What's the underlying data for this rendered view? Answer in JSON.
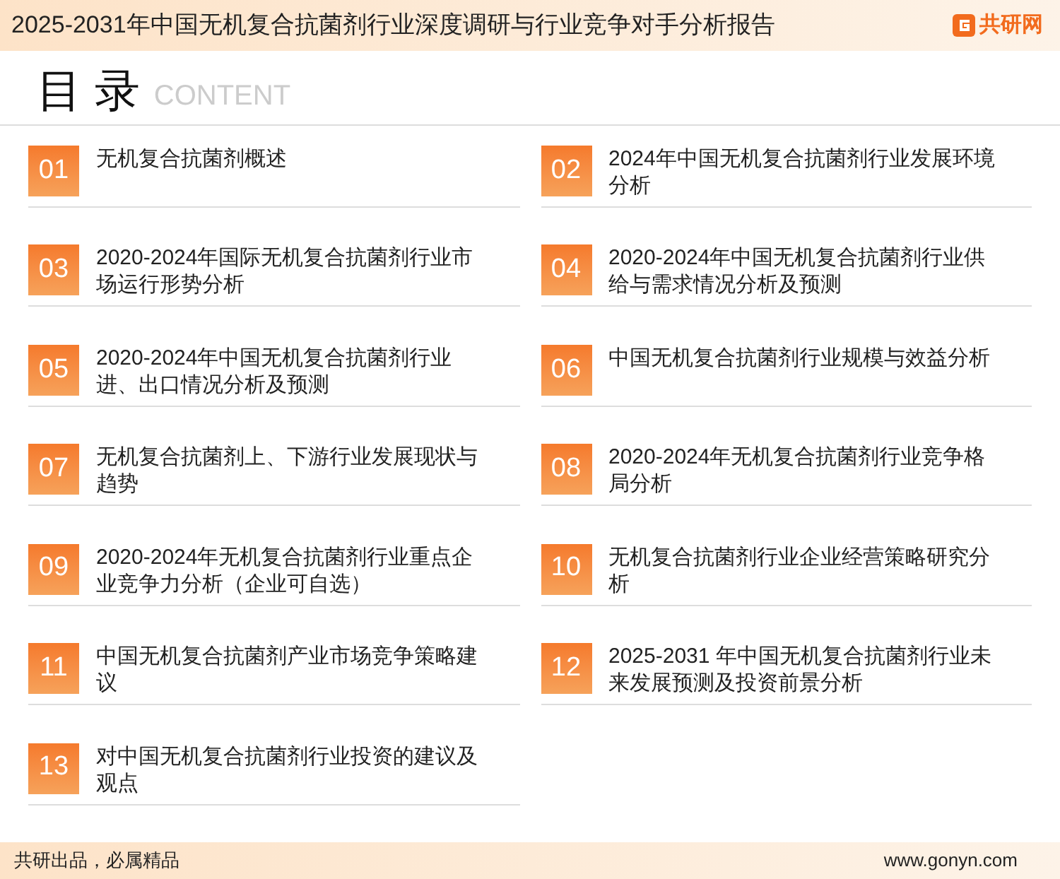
{
  "header": {
    "title": "2025-2031年中国无机复合抗菌剂行业深度调研与行业竞争对手分析报告",
    "logo": "共研网"
  },
  "section": {
    "title": "目 录",
    "subtitle": "CONTENT"
  },
  "items": [
    {
      "number": "01",
      "text": "无机复合抗菌剂概述"
    },
    {
      "number": "02",
      "text": "2024年中国无机复合抗菌剂行业发展环境分析"
    },
    {
      "number": "03",
      "text": "2020-2024年国际无机复合抗菌剂行业市场运行形势分析"
    },
    {
      "number": "04",
      "text": "2020-2024年中国无机复合抗菌剂行业供给与需求情况分析及预测"
    },
    {
      "number": "05",
      "text": "2020-2024年中国无机复合抗菌剂行业进、出口情况分析及预测"
    },
    {
      "number": "06",
      "text": "中国无机复合抗菌剂行业规模与效益分析"
    },
    {
      "number": "07",
      "text": "无机复合抗菌剂上、下游行业发展现状与趋势"
    },
    {
      "number": "08",
      "text": "2020-2024年无机复合抗菌剂行业竞争格局分析"
    },
    {
      "number": "09",
      "text": "2020-2024年无机复合抗菌剂行业重点企业竞争力分析（企业可自选）"
    },
    {
      "number": "10",
      "text": "无机复合抗菌剂行业企业经营策略研究分析"
    },
    {
      "number": "11",
      "text": "中国无机复合抗菌剂产业市场竞争策略建议"
    },
    {
      "number": "12",
      "text": "2025-2031 年中国无机复合抗菌剂行业未来发展预测及投资前景分析"
    },
    {
      "number": "13",
      "text": "对中国无机复合抗菌剂行业投资的建议及观点"
    }
  ],
  "footer": {
    "slogan": "共研出品，必属精品",
    "url": "www.gonyn.com"
  }
}
